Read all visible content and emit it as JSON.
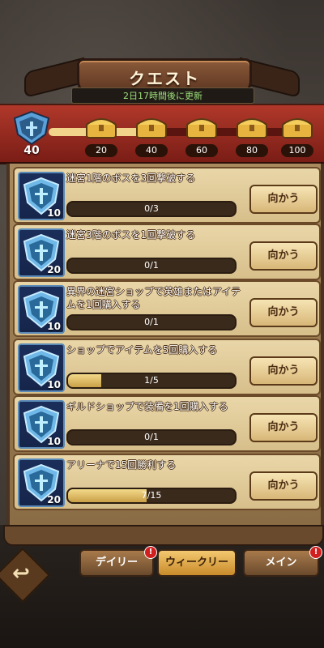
{
  "header": {
    "title": "クエスト",
    "refresh_text": "2日17時間後に更新"
  },
  "progress": {
    "current_points": "40",
    "fill_fraction": 0.4,
    "milestones": [
      {
        "points": "20",
        "icon": "chest-icon"
      },
      {
        "points": "40",
        "icon": "chest-icon"
      },
      {
        "points": "60",
        "icon": "chest-icon"
      },
      {
        "points": "80",
        "icon": "chest-icon"
      },
      {
        "points": "100",
        "icon": "chest-icon"
      }
    ]
  },
  "quests": [
    {
      "title": "迷宮1階のボスを3回撃破する",
      "reward": "10",
      "progress_text": "0/3",
      "fraction": 0.0,
      "button": "向かう"
    },
    {
      "title": "迷宮3階のボスを1回撃破する",
      "reward": "20",
      "progress_text": "0/1",
      "fraction": 0.0,
      "button": "向かう"
    },
    {
      "title": "異界の迷宮ショップで英雄またはアイテムを1回購入する",
      "reward": "10",
      "progress_text": "0/1",
      "fraction": 0.0,
      "button": "向かう"
    },
    {
      "title": "ショップでアイテムを5回購入する",
      "reward": "10",
      "progress_text": "1/5",
      "fraction": 0.2,
      "button": "向かう"
    },
    {
      "title": "ギルドショップで装備を1回購入する",
      "reward": "10",
      "progress_text": "0/1",
      "fraction": 0.0,
      "button": "向かう"
    },
    {
      "title": "アリーナで15回勝利する",
      "reward": "20",
      "progress_text": "7/15",
      "fraction": 0.47,
      "button": "向かう"
    }
  ],
  "tabs": {
    "daily": "デイリー",
    "weekly": "ウィークリー",
    "main": "メイン",
    "badge": "!"
  },
  "colors": {
    "accent": "#f3c870",
    "rail": "#b0382a",
    "refresh_text": "#9de07a"
  }
}
